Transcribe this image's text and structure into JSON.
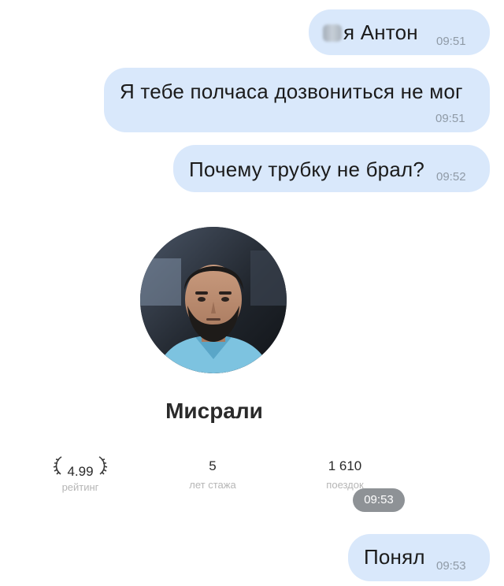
{
  "messages": [
    {
      "text": "я Антон",
      "time": "09:51"
    },
    {
      "text": "Я тебе полчаса дозвониться не мог",
      "time": "09:51"
    },
    {
      "text": "Почему трубку не брал?",
      "time": "09:52"
    },
    {
      "text": "Понял",
      "time": "09:53"
    }
  ],
  "driver_card": {
    "name": "Мисрали",
    "stats": [
      {
        "value": "4.99",
        "label": "рейтинг"
      },
      {
        "value": "5",
        "label": "лет стажа"
      },
      {
        "value": "1 610",
        "label": "поездок"
      }
    ],
    "time": "09:53"
  }
}
